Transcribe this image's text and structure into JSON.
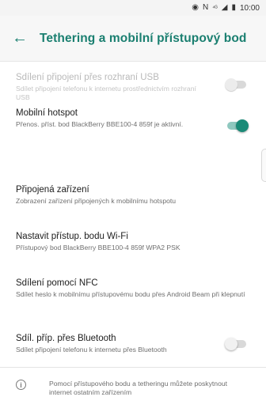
{
  "status_bar": {
    "icons": [
      "nfc-icon",
      "signal-icon",
      "battery-icon"
    ],
    "signal_text": "⁴ᴳ",
    "time": "10:00"
  },
  "app_bar": {
    "back_icon": "arrow-back-icon",
    "title": "Tethering a mobilní přístupový bod"
  },
  "settings": [
    {
      "title": "Sdílení připojení přes rozhraní USB",
      "subtitle": "Sdílet připojení telefonu k internetu prostřednictvím rozhraní USB",
      "toggle": "off",
      "enabled": false
    },
    {
      "title": "Mobilní hotspot",
      "subtitle": "Přenos. příst. bod BlackBerry BBE100-4 859f je aktivní.",
      "toggle": "on",
      "enabled": true
    },
    {
      "title": "Připojená zařízení",
      "subtitle": "Zobrazení zařízení připojených k mobilnímu hotspotu",
      "enabled": true
    },
    {
      "title": "Nastavit přístup. bodu Wi-Fi",
      "subtitle": "Přístupový bod BlackBerry BBE100-4 859f WPA2 PSK",
      "enabled": true
    },
    {
      "title": "Sdílení pomocí NFC",
      "subtitle": "Sdílet heslo k mobilnímu přístupovému bodu přes Android Beam při klepnutí",
      "enabled": true
    },
    {
      "title": "Sdíl. příp. přes Bluetooth",
      "subtitle": "Sdílet připojení telefonu k internetu přes Bluetooth",
      "toggle": "off",
      "enabled": true
    }
  ],
  "footer": {
    "icon": "info-icon",
    "text": "Pomocí přístupového bodu a tetheringu můžete poskytnout internet ostatním zařízením"
  },
  "colors": {
    "accent": "#1a7f70",
    "switch_on": "#1a8a77"
  }
}
